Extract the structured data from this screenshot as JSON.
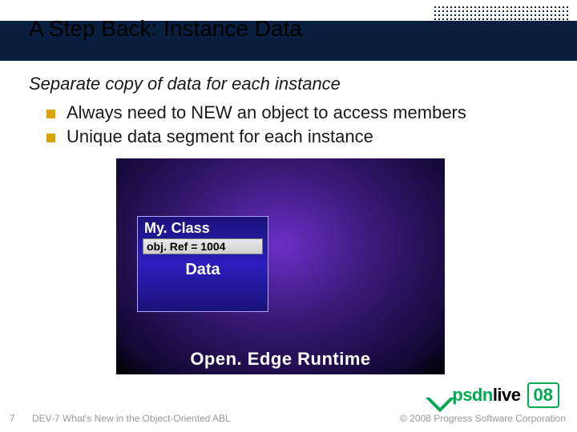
{
  "title": "A Step Back: Instance Data",
  "subhead": "Separate copy of data for each instance",
  "bullets": {
    "b1": "Always need to NEW an object to access members",
    "b2": "Unique data segment for each instance"
  },
  "diagram": {
    "runtime_label": "Open. Edge Runtime",
    "instance": {
      "class_name": "My. Class",
      "objref_label": "obj. Ref = 1004",
      "data_label": "Data"
    }
  },
  "footer": {
    "page_num": "7",
    "note": "DEV-7 What's New in the Object-Oriented ABL",
    "copyright": "© 2008 Progress Software Corporation"
  },
  "logo": {
    "psdn": "psdn",
    "live": "live",
    "year": "08"
  }
}
